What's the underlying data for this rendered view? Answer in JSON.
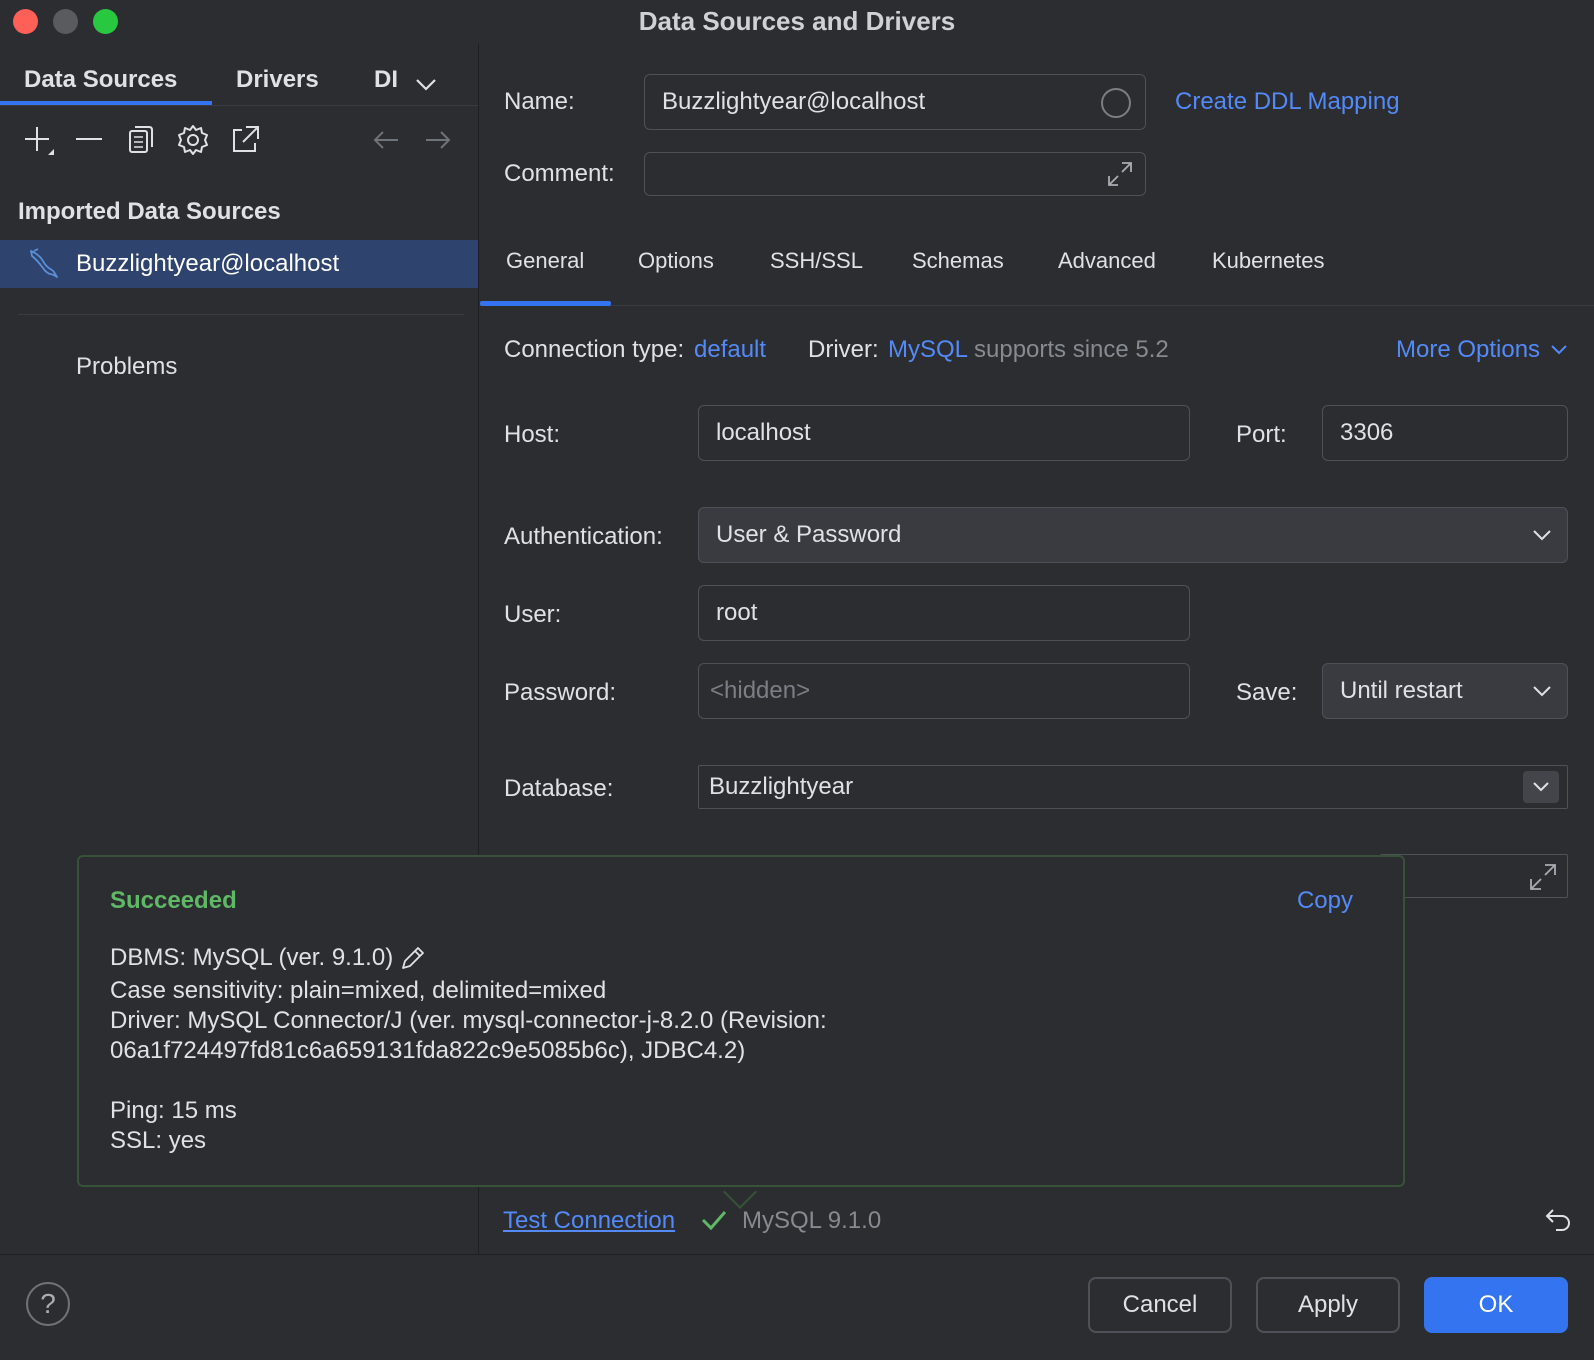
{
  "window": {
    "title": "Data Sources and Drivers"
  },
  "left": {
    "tabs": [
      "Data Sources",
      "Drivers",
      "DI"
    ],
    "section_header": "Imported Data Sources",
    "data_source": "Buzzlightyear@localhost",
    "problems": "Problems"
  },
  "top": {
    "name_label": "Name:",
    "name_value": "Buzzlightyear@localhost",
    "comment_label": "Comment:",
    "comment_value": "",
    "ddl_link": "Create DDL Mapping"
  },
  "tabs": [
    "General",
    "Options",
    "SSH/SSL",
    "Schemas",
    "Advanced",
    "Kubernetes"
  ],
  "connection": {
    "type_label": "Connection type:",
    "type_value": "default",
    "driver_label": "Driver:",
    "driver_value": "MySQL",
    "driver_note": "supports since 5.2",
    "more_options": "More Options"
  },
  "form": {
    "host_label": "Host:",
    "host_value": "localhost",
    "port_label": "Port:",
    "port_value": "3306",
    "auth_label": "Authentication:",
    "auth_value": "User & Password",
    "user_label": "User:",
    "user_value": "root",
    "password_label": "Password:",
    "password_placeholder": "<hidden>",
    "save_label": "Save:",
    "save_value": "Until restart",
    "database_label": "Database:",
    "database_value": "Buzzlightyear"
  },
  "popup": {
    "status": "Succeeded",
    "copy": "Copy",
    "dbms": "DBMS: MySQL (ver. 9.1.0)",
    "case_sensitivity": "Case sensitivity: plain=mixed, delimited=mixed",
    "driver_line1": "Driver: MySQL Connector/J (ver. mysql-connector-j-8.2.0 (Revision:",
    "driver_line2": "06a1f724497fd81c6a659131fda822c9e5085b6c), JDBC4.2)",
    "ping": "Ping: 15 ms",
    "ssl": "SSL: yes"
  },
  "test": {
    "link": "Test Connection",
    "result": "MySQL 9.1.0"
  },
  "buttons": {
    "help": "?",
    "cancel": "Cancel",
    "apply": "Apply",
    "ok": "OK"
  },
  "colors": {
    "accent": "#3574f0",
    "link": "#548af7",
    "success": "#5fb865",
    "background": "#2b2d30",
    "selection": "#2e436e"
  }
}
